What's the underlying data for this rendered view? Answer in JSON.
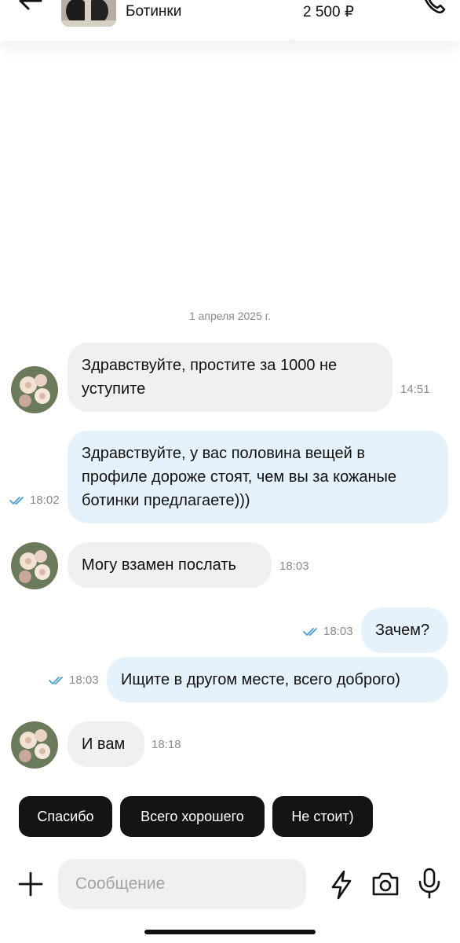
{
  "header": {
    "product_name": "Ботинки",
    "product_price": "2 500 ₽"
  },
  "date_separator": "1 апреля 2025 г.",
  "messages": [
    {
      "direction": "in",
      "text": "Здравствуйте, простите за 1000 не уступите",
      "time": "14:51"
    },
    {
      "direction": "out",
      "text": "Здравствуйте, у вас половина вещей в профиле дороже стоят, чем вы за кожаные ботинки предлагаете)))",
      "time": "18:02",
      "read": true
    },
    {
      "direction": "in",
      "text": "Могу взамен послать",
      "time": "18:03"
    },
    {
      "direction": "out",
      "text": "Зачем?",
      "time": "18:03",
      "read": true
    },
    {
      "direction": "out",
      "text": "Ищите в другом месте, всего доброго)",
      "time": "18:03",
      "read": true
    },
    {
      "direction": "in",
      "text": "И вам",
      "time": "18:18"
    }
  ],
  "quick_replies": [
    "Спасибо",
    "Всего хорошего",
    "Не стоит)"
  ],
  "composer": {
    "placeholder": "Сообщение"
  },
  "icons": {
    "back": "arrow-left-icon",
    "call": "phone-icon",
    "attach": "plus-icon",
    "templates": "lightning-icon",
    "camera": "camera-icon",
    "voice": "microphone-icon",
    "read_receipt": "double-check-icon"
  },
  "colors": {
    "incoming_bubble": "#f1f0ef",
    "outgoing_bubble": "#e6f2fb",
    "chip_background": "#141414",
    "read_check": "#4a9fd8"
  }
}
